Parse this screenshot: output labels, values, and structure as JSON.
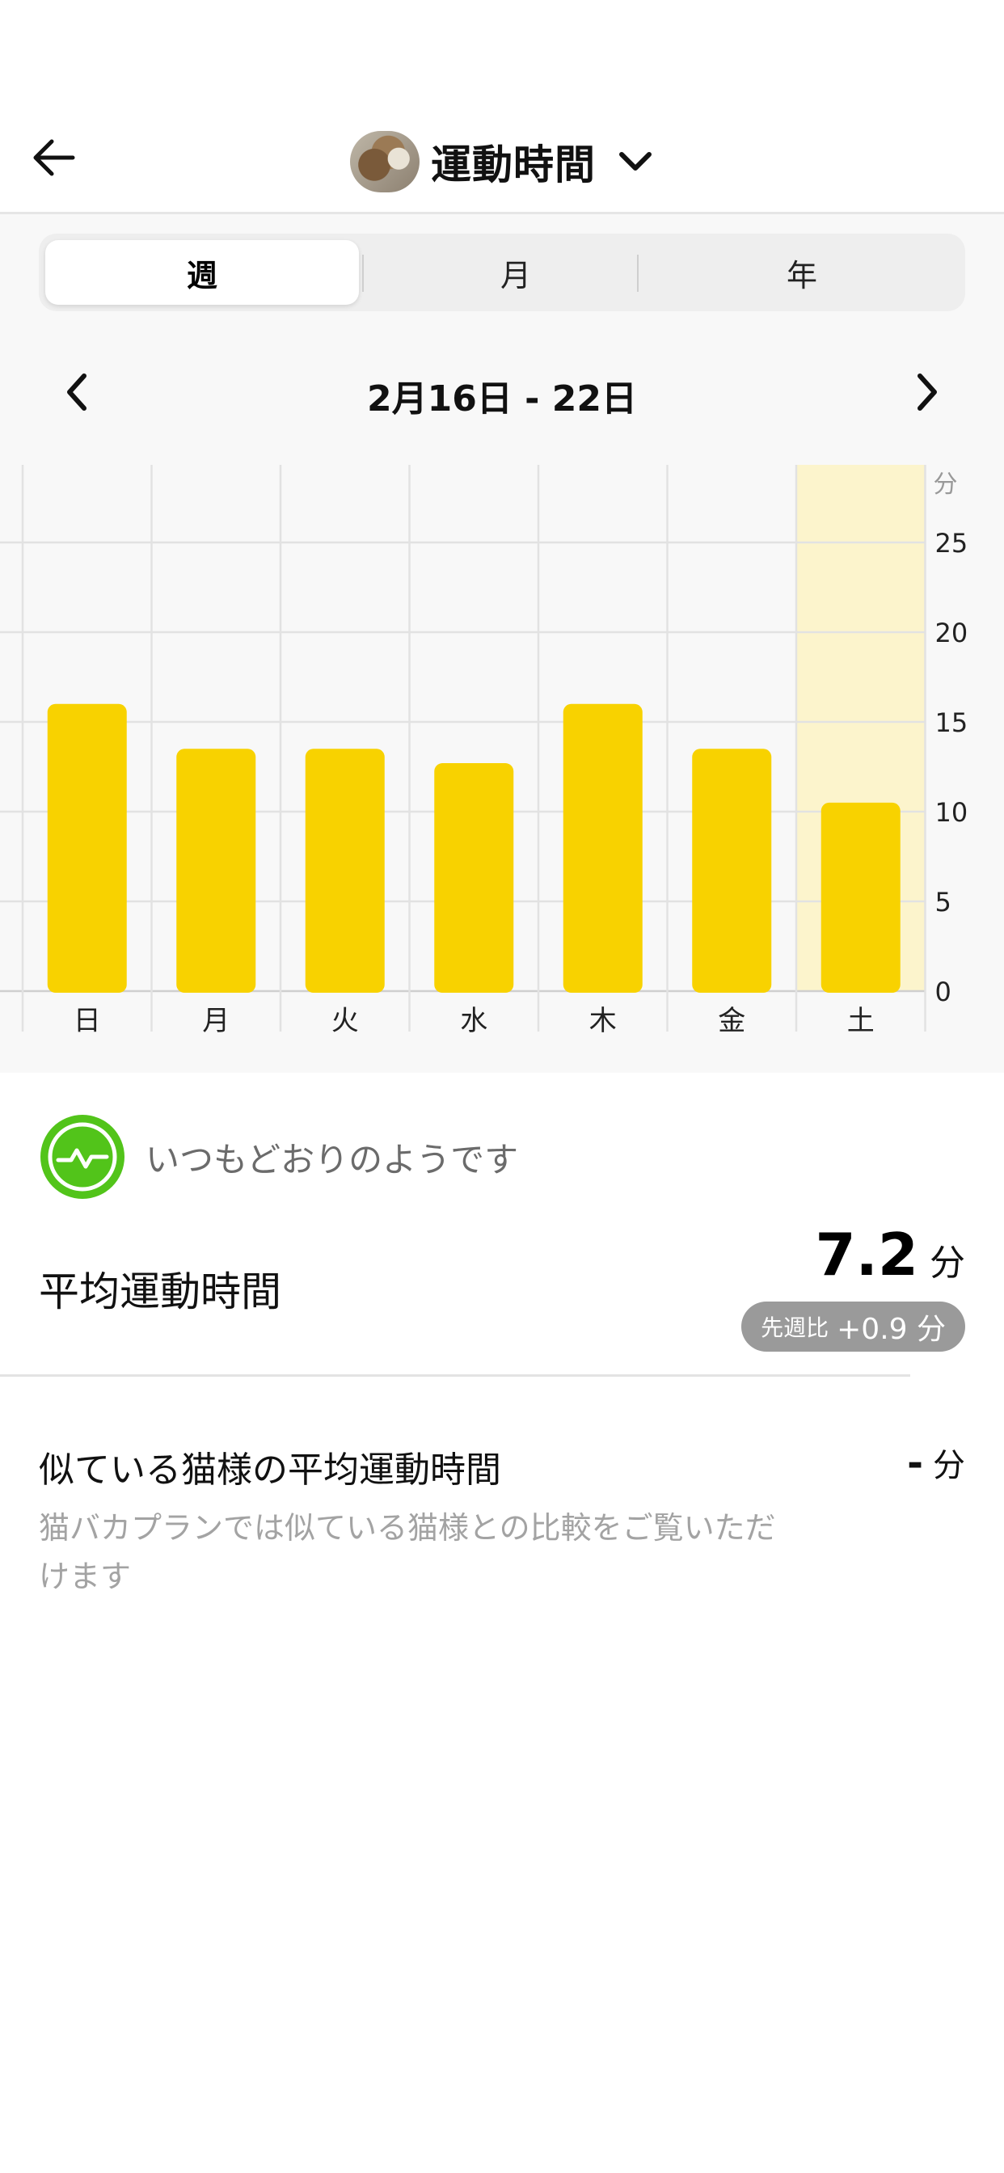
{
  "header": {
    "title": "運動時間",
    "back_icon": "arrow-left-icon",
    "dropdown_icon": "chevron-down-icon"
  },
  "segment": {
    "tabs": [
      {
        "label": "週",
        "active": true
      },
      {
        "label": "月",
        "active": false
      },
      {
        "label": "年",
        "active": false
      }
    ]
  },
  "date_nav": {
    "label": "2月16日 - 22日",
    "prev_icon": "chevron-left-icon",
    "next_icon": "chevron-right-icon"
  },
  "chart_data": {
    "type": "bar",
    "categories": [
      "日",
      "月",
      "火",
      "水",
      "木",
      "金",
      "土"
    ],
    "values": [
      16,
      13.5,
      13.5,
      12.7,
      16,
      13.5,
      10.5
    ],
    "y_unit": "分",
    "y_ticks": [
      0,
      5,
      10,
      15,
      20,
      25
    ],
    "ylim": [
      0,
      29
    ],
    "highlight_category": "土",
    "bar_color": "#f8d200",
    "highlight_bg": "#fcf4cc",
    "grid": true
  },
  "status": {
    "icon": "activity-pulse-icon",
    "text": "いつもどおりのようです",
    "color": "#52c41a"
  },
  "average": {
    "label": "平均運動時間",
    "value": "7.2",
    "unit": "分",
    "compare_label": "先週比",
    "compare_value": "+0.9 分"
  },
  "similar": {
    "label": "似ている猫様の平均運動時間",
    "value": "-",
    "unit": "分",
    "note": "猫バカプランでは似ている猫様との比較をご覧いただけます"
  }
}
